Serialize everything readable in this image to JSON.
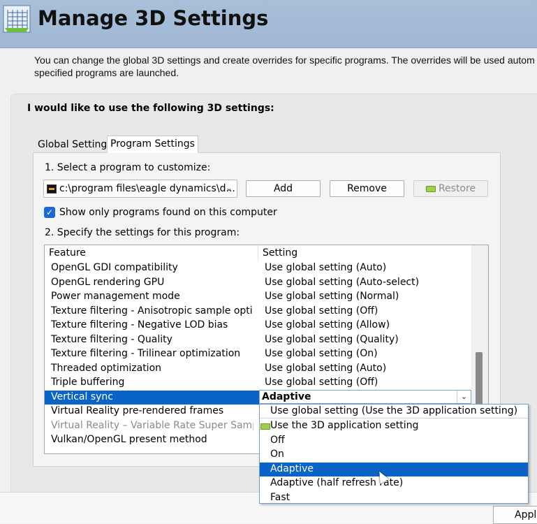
{
  "header": {
    "title": "Manage 3D Settings",
    "icon": "3d-cube-icon"
  },
  "description": {
    "line1": "You can change the global 3D settings and create overrides for specific programs. The overrides will be used autom",
    "line2": "specified programs are launched."
  },
  "panel": {
    "title": "I would like to use the following 3D settings:"
  },
  "tabs": [
    {
      "label": "Global Settings"
    },
    {
      "label": "Program Settings"
    }
  ],
  "program": {
    "step1_label": "1. Select a program to customize:",
    "selected": "c:\\program files\\eagle dynamics\\d...",
    "chevron": "⌄",
    "add_label": "Add",
    "remove_label": "Remove",
    "restore_label": "Restore",
    "show_only_label": "Show only programs found on this computer",
    "show_only_checked": true,
    "step2_label": "2. Specify the settings for this program:"
  },
  "table": {
    "col_feature": "Feature",
    "col_setting": "Setting",
    "rows": [
      {
        "feature": "OpenGL GDI compatibility",
        "setting": "Use global setting (Auto)"
      },
      {
        "feature": "OpenGL rendering GPU",
        "setting": "Use global setting (Auto-select)"
      },
      {
        "feature": "Power management mode",
        "setting": "Use global setting (Normal)"
      },
      {
        "feature": "Texture filtering - Anisotropic sample opti...",
        "setting": "Use global setting (Off)"
      },
      {
        "feature": "Texture filtering - Negative LOD bias",
        "setting": "Use global setting (Allow)"
      },
      {
        "feature": "Texture filtering - Quality",
        "setting": "Use global setting (Quality)"
      },
      {
        "feature": "Texture filtering - Trilinear optimization",
        "setting": "Use global setting (On)"
      },
      {
        "feature": "Threaded optimization",
        "setting": "Use global setting (Auto)"
      },
      {
        "feature": "Triple buffering",
        "setting": "Use global setting (Off)"
      },
      {
        "feature": "Vertical sync",
        "setting": ""
      },
      {
        "feature": "Virtual Reality pre-rendered frames",
        "setting": ""
      },
      {
        "feature": "Virtual Reality – Variable Rate Super Sampli...",
        "setting": ""
      },
      {
        "feature": "Vulkan/OpenGL present method",
        "setting": ""
      }
    ]
  },
  "combo": {
    "value": "Adaptive",
    "arrow": "⌄"
  },
  "dropdown": {
    "options": [
      "Use global setting (Use the 3D application setting)",
      "Use the 3D application setting",
      "Off",
      "On",
      "Adaptive",
      "Adaptive (half refresh rate)",
      "Fast"
    ],
    "selected": "Adaptive"
  },
  "footer": {
    "apply_label": "Appl"
  }
}
